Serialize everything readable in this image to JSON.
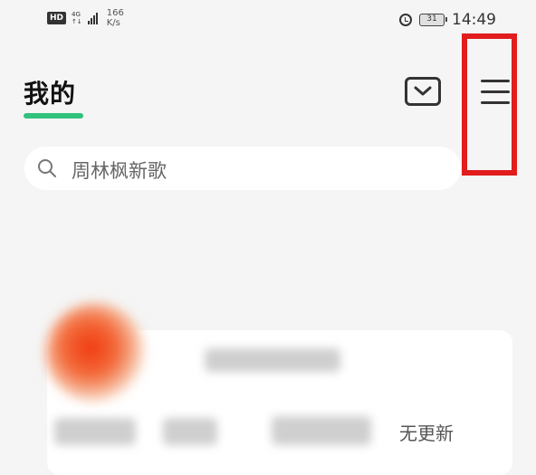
{
  "statusbar": {
    "hd": "HD",
    "net_top": "4G",
    "net_bottom": "↑↓",
    "speed_value": "166",
    "speed_unit": "K/s",
    "battery": "31",
    "time": "14:49"
  },
  "header": {
    "title": "我的",
    "accent_color": "#31c27c"
  },
  "search": {
    "placeholder": "周林枫新歌"
  },
  "card": {
    "status": "无更新"
  },
  "highlight_color": "#e11d1d",
  "icons": [
    "hd-icon",
    "signal-icon",
    "alarm-icon",
    "battery-icon",
    "mail-icon",
    "menu-icon",
    "search-icon"
  ]
}
